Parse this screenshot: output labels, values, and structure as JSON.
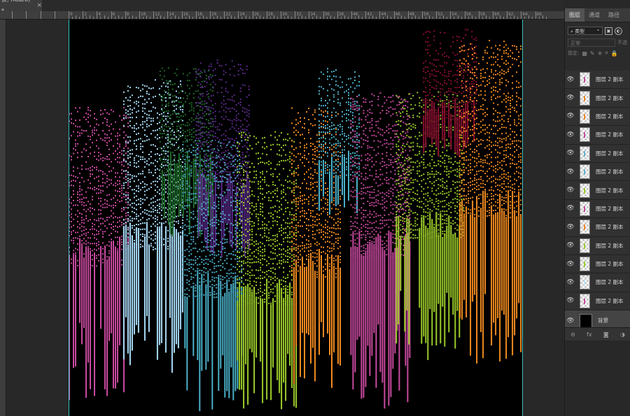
{
  "document": {
    "tab_title": "景, RGB/8) *",
    "close_glyph": "×"
  },
  "ruler_top": {
    "labels": [
      "0",
      "2",
      "4",
      "6",
      "8",
      "10",
      "12",
      "14",
      "16",
      "18",
      "20",
      "22",
      "24",
      "26",
      "28",
      "30",
      "32",
      "34",
      "36",
      "38",
      "40",
      "42",
      "44",
      "46",
      "48",
      "50",
      "52",
      "54",
      "56",
      "58",
      "60",
      "62",
      "64",
      "66"
    ]
  },
  "panel": {
    "tabs": [
      "图层",
      "通道",
      "路径"
    ],
    "active_tab": 0,
    "filter_label": "类型",
    "filter_icons": [
      "image-filter",
      "adjust-filter"
    ],
    "blend_mode": "正常",
    "opacity_label": "不透",
    "lock_label": "锁定:",
    "layers": [
      {
        "name": "图层 2 副本",
        "mark_color": "#c94aa0"
      },
      {
        "name": "图层 2 副本",
        "mark_color": "#f08a1f"
      },
      {
        "name": "图层 2 副本",
        "mark_color": "#f08a1f"
      },
      {
        "name": "图层 2 副本",
        "mark_color": "#c94aa0"
      },
      {
        "name": "图层 2 副本",
        "mark_color": "#5fb3cf"
      },
      {
        "name": "图层 2 副本",
        "mark_color": "#5fb3cf"
      },
      {
        "name": "图层 2 副本",
        "mark_color": "#9ccc2a"
      },
      {
        "name": "图层 2 副本",
        "mark_color": "#c94aa0"
      },
      {
        "name": "图层 2 副本",
        "mark_color": "#f08a1f"
      },
      {
        "name": "图层 2 副本",
        "mark_color": "#9ccc2a"
      },
      {
        "name": "图层 2 副本",
        "mark_color": "#9ccc2a"
      },
      {
        "name": "图层 2 副本",
        "mark_color": "#bfe6ff"
      },
      {
        "name": "图层 2 副本",
        "mark_color": "#c94aa0"
      }
    ],
    "background_layer": "背景",
    "bottom_icons": [
      "link",
      "fx",
      "mask",
      "adjustment"
    ]
  },
  "colors": {
    "magenta": "#c94aa0",
    "light_blue": "#a8dcf8",
    "dark_green": "#1f6b2a",
    "purple": "#5a2a8a",
    "teal": "#4ab0c8",
    "lime": "#9ccc2a",
    "orange": "#f08a1f",
    "dark_red": "#8a1030",
    "guide": "#3ee0e0"
  },
  "art_bands": [
    {
      "color": "magenta",
      "from": 0.0,
      "to": 0.13,
      "top": 0.22,
      "bottom": 0.96,
      "dense": 0.62
    },
    {
      "color": "light_blue",
      "from": 0.12,
      "to": 0.25,
      "top": 0.15,
      "bottom": 0.9,
      "dense": 0.58
    },
    {
      "color": "dark_green",
      "from": 0.2,
      "to": 0.32,
      "top": 0.12,
      "bottom": 0.55,
      "dense": 0.4
    },
    {
      "color": "purple",
      "from": 0.28,
      "to": 0.4,
      "top": 0.1,
      "bottom": 0.6,
      "dense": 0.45
    },
    {
      "color": "teal",
      "from": 0.25,
      "to": 0.38,
      "top": 0.3,
      "bottom": 0.99,
      "dense": 0.7
    },
    {
      "color": "lime",
      "from": 0.37,
      "to": 0.5,
      "top": 0.28,
      "bottom": 0.99,
      "dense": 0.72
    },
    {
      "color": "orange",
      "from": 0.49,
      "to": 0.6,
      "top": 0.22,
      "bottom": 0.93,
      "dense": 0.65
    },
    {
      "color": "teal",
      "from": 0.55,
      "to": 0.64,
      "top": 0.12,
      "bottom": 0.5,
      "dense": 0.4
    },
    {
      "color": "magenta",
      "from": 0.62,
      "to": 0.75,
      "top": 0.18,
      "bottom": 0.99,
      "dense": 0.6
    },
    {
      "color": "lime",
      "from": 0.72,
      "to": 0.87,
      "top": 0.18,
      "bottom": 0.86,
      "dense": 0.55
    },
    {
      "color": "dark_red",
      "from": 0.78,
      "to": 0.9,
      "top": 0.02,
      "bottom": 0.35,
      "dense": 0.25
    },
    {
      "color": "orange",
      "from": 0.86,
      "to": 1.0,
      "top": 0.05,
      "bottom": 0.9,
      "dense": 0.5
    }
  ]
}
